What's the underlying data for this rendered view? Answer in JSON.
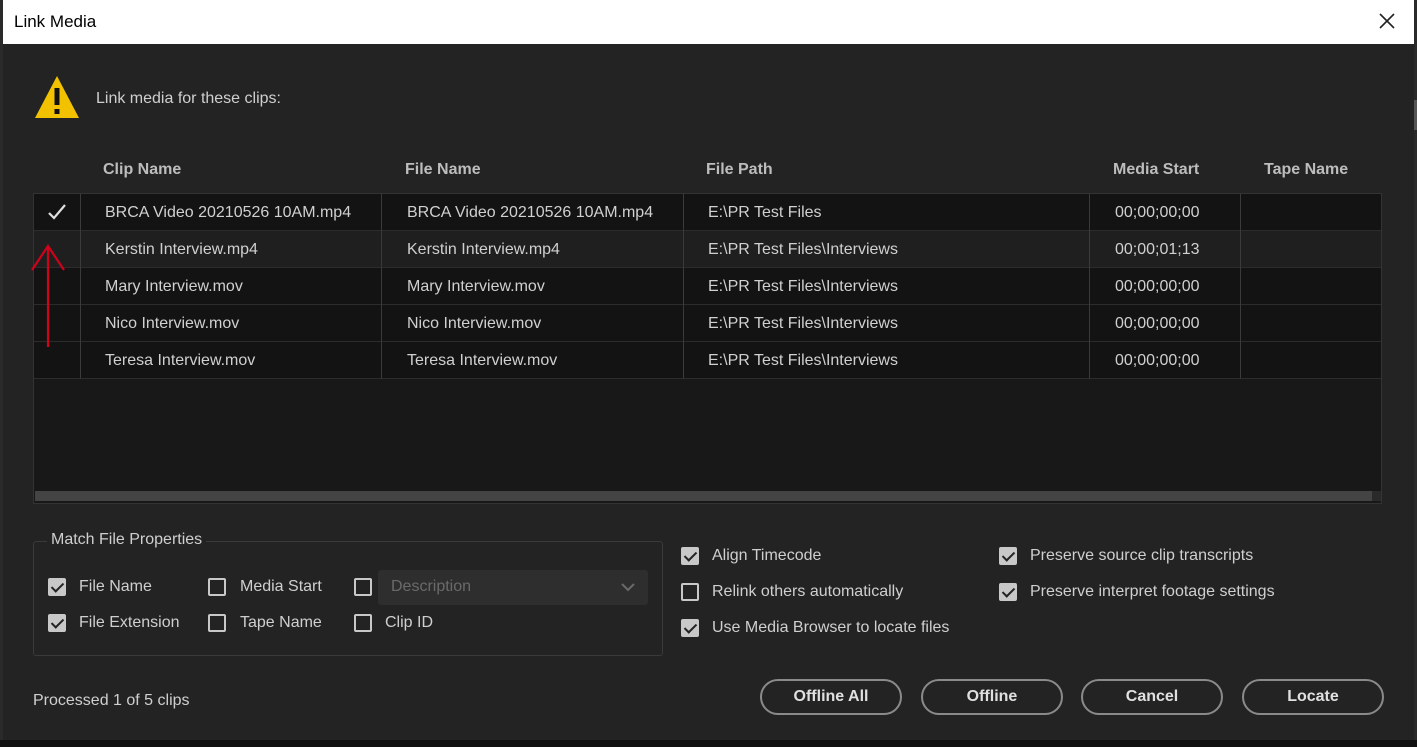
{
  "window": {
    "title": "Link Media"
  },
  "header": {
    "message": "Link media for these clips:"
  },
  "table": {
    "columns": [
      "Clip Name",
      "File Name",
      "File Path",
      "Media Start",
      "Tape Name"
    ],
    "rows": [
      {
        "checked": true,
        "clip_name": "BRCA Video 20210526 10AM.mp4",
        "file_name": "BRCA Video 20210526 10AM.mp4",
        "file_path": "E:\\PR Test Files",
        "media_start": "00;00;00;00",
        "tape_name": ""
      },
      {
        "checked": false,
        "clip_name": "Kerstin Interview.mp4",
        "file_name": "Kerstin Interview.mp4",
        "file_path": "E:\\PR Test Files\\Interviews",
        "media_start": "00;00;01;13",
        "tape_name": ""
      },
      {
        "checked": false,
        "clip_name": "Mary Interview.mov",
        "file_name": "Mary Interview.mov",
        "file_path": "E:\\PR Test Files\\Interviews",
        "media_start": "00;00;00;00",
        "tape_name": ""
      },
      {
        "checked": false,
        "clip_name": "Nico Interview.mov",
        "file_name": "Nico Interview.mov",
        "file_path": "E:\\PR Test Files\\Interviews",
        "media_start": "00;00;00;00",
        "tape_name": ""
      },
      {
        "checked": false,
        "clip_name": "Teresa Interview.mov",
        "file_name": "Teresa Interview.mov",
        "file_path": "E:\\PR Test Files\\Interviews",
        "media_start": "00;00;00;00",
        "tape_name": ""
      }
    ]
  },
  "match_file_properties": {
    "legend": "Match File Properties",
    "file_name": {
      "label": "File Name",
      "checked": true
    },
    "file_extension": {
      "label": "File Extension",
      "checked": true
    },
    "media_start": {
      "label": "Media Start",
      "checked": false
    },
    "tape_name": {
      "label": "Tape Name",
      "checked": false
    },
    "description": {
      "checked": false,
      "placeholder": "Description"
    },
    "clip_id": {
      "label": "Clip ID",
      "checked": false
    }
  },
  "options": {
    "align_timecode": {
      "label": "Align Timecode",
      "checked": true
    },
    "relink_others": {
      "label": "Relink others automatically",
      "checked": false
    },
    "use_media_browser": {
      "label": "Use Media Browser to locate files",
      "checked": true
    },
    "preserve_transcripts": {
      "label": "Preserve source clip transcripts",
      "checked": true
    },
    "preserve_interpret": {
      "label": "Preserve interpret footage settings",
      "checked": true
    }
  },
  "status": "Processed 1 of 5 clips",
  "buttons": {
    "offline_all": "Offline All",
    "offline": "Offline",
    "cancel": "Cancel",
    "locate": "Locate"
  },
  "colors": {
    "annotation_arrow": "#d0021b",
    "warning": "#f2c200",
    "dialog_bg": "#232323"
  }
}
